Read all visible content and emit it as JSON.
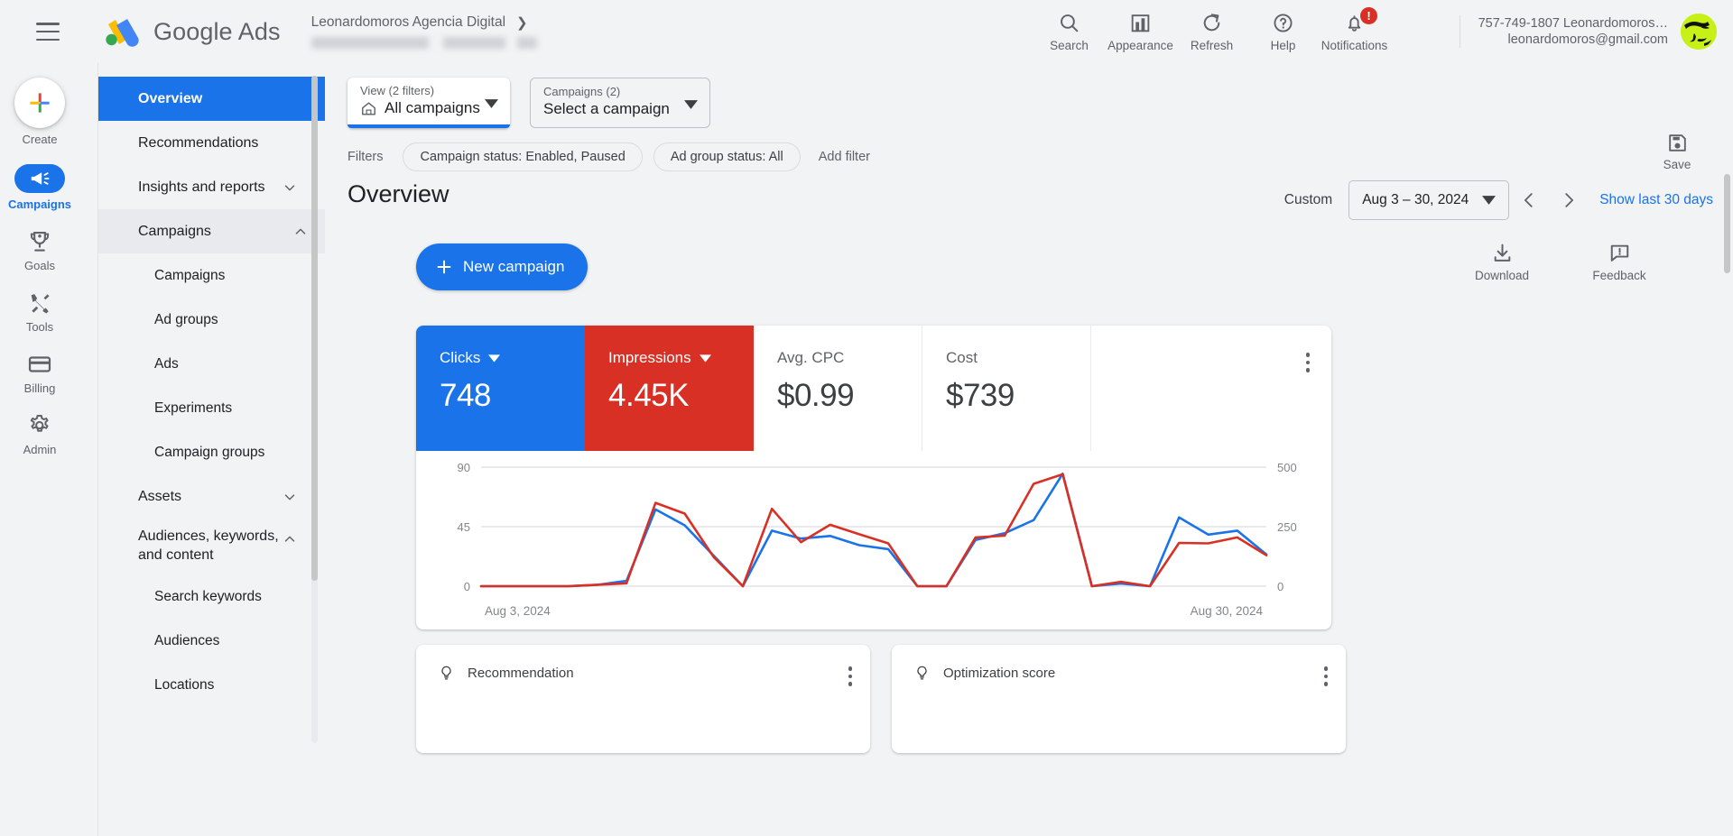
{
  "topbar": {
    "brand_google": "Google",
    "brand_ads": "Ads",
    "account_breadcrumb": "Leonardomoros Agencia Digital",
    "tools": [
      {
        "label": "Search",
        "icon": "search-icon"
      },
      {
        "label": "Appearance",
        "icon": "appearance-icon"
      },
      {
        "label": "Refresh",
        "icon": "refresh-icon"
      },
      {
        "label": "Help",
        "icon": "help-icon"
      },
      {
        "label": "Notifications",
        "icon": "bell-icon",
        "badge": "!"
      }
    ],
    "account_id": "757-749-1807 Leonardomoros…",
    "account_email": "leonardomoros@gmail.com"
  },
  "rail": {
    "items": [
      {
        "label": "Create",
        "icon": "plus-icon"
      },
      {
        "label": "Campaigns",
        "icon": "megaphone-icon",
        "active": true
      },
      {
        "label": "Goals",
        "icon": "trophy-icon"
      },
      {
        "label": "Tools",
        "icon": "tools-icon"
      },
      {
        "label": "Billing",
        "icon": "credit-card-icon"
      },
      {
        "label": "Admin",
        "icon": "gear-icon"
      }
    ]
  },
  "sidebar": {
    "items": [
      {
        "label": "Overview",
        "state": "selected"
      },
      {
        "label": "Recommendations",
        "state": "normal"
      },
      {
        "label": "Insights and reports",
        "state": "collapsed"
      },
      {
        "label": "Campaigns",
        "state": "expanded"
      },
      {
        "label": "Campaigns",
        "state": "child"
      },
      {
        "label": "Ad groups",
        "state": "child"
      },
      {
        "label": "Ads",
        "state": "child"
      },
      {
        "label": "Experiments",
        "state": "child"
      },
      {
        "label": "Campaign groups",
        "state": "child"
      },
      {
        "label": "Assets",
        "state": "collapsed"
      },
      {
        "label": "Audiences, keywords, and content",
        "state": "expanded_two_line"
      },
      {
        "label": "Search keywords",
        "state": "child"
      },
      {
        "label": "Audiences",
        "state": "child"
      },
      {
        "label": "Locations",
        "state": "child"
      }
    ]
  },
  "main": {
    "view_selector": {
      "caption": "View (2 filters)",
      "value": "All campaigns"
    },
    "campaign_selector": {
      "caption": "Campaigns (2)",
      "value": "Select a campaign"
    },
    "filters_label": "Filters",
    "filter_chips": [
      "Campaign status: Enabled, Paused",
      "Ad group status: All"
    ],
    "add_filter": "Add filter",
    "save_label": "Save",
    "page_title": "Overview",
    "date_custom_label": "Custom",
    "date_range": "Aug 3 – 30, 2024",
    "show_last_30": "Show last 30 days",
    "new_campaign": "New campaign",
    "download_label": "Download",
    "feedback_label": "Feedback",
    "stats": [
      {
        "name": "Clicks",
        "value": "748",
        "style": "blue",
        "has_caret": true
      },
      {
        "name": "Impressions",
        "value": "4.45K",
        "style": "red",
        "has_caret": true
      },
      {
        "name": "Avg. CPC",
        "value": "$0.99",
        "style": "plain",
        "has_caret": false
      },
      {
        "name": "Cost",
        "value": "$739",
        "style": "plain",
        "has_caret": false
      }
    ],
    "bottom_cards": [
      {
        "title": "Recommendation",
        "icon": "lightbulb-icon"
      },
      {
        "title": "Optimization score",
        "icon": "lightbulb-icon"
      }
    ]
  },
  "chart_data": {
    "type": "line",
    "title": "",
    "xlabel": "",
    "ylabel": "Clicks",
    "grid": true,
    "legend": "none",
    "x_tick_labels": [
      "Aug 3, 2024",
      "Aug 30, 2024"
    ],
    "left_axis": {
      "name": "Clicks",
      "ticks": [
        0,
        45,
        90
      ],
      "ylim": [
        0,
        90
      ],
      "color": "#1a73e8"
    },
    "right_axis": {
      "name": "Impressions",
      "ticks": [
        0,
        250,
        500
      ],
      "ylim": [
        0,
        500
      ],
      "color": "#d93025"
    },
    "x": [
      "Aug 3",
      "Aug 4",
      "Aug 5",
      "Aug 6",
      "Aug 7",
      "Aug 8",
      "Aug 9",
      "Aug 10",
      "Aug 11",
      "Aug 12",
      "Aug 13",
      "Aug 14",
      "Aug 15",
      "Aug 16",
      "Aug 17",
      "Aug 18",
      "Aug 19",
      "Aug 20",
      "Aug 21",
      "Aug 22",
      "Aug 23",
      "Aug 24",
      "Aug 25",
      "Aug 26",
      "Aug 27",
      "Aug 28",
      "Aug 29",
      "Aug 30"
    ],
    "series": [
      {
        "name": "Clicks",
        "color": "#1a73e8",
        "axis": "left",
        "values": [
          0,
          0,
          0,
          0,
          1,
          4,
          58,
          46,
          23,
          0,
          42,
          36,
          38,
          31,
          28,
          0,
          0,
          35,
          40,
          50,
          85,
          0,
          2,
          0,
          52,
          39,
          42,
          24
        ]
      },
      {
        "name": "Impressions",
        "color": "#d93025",
        "axis": "right",
        "values": [
          0,
          0,
          0,
          0,
          6,
          12,
          350,
          305,
          122,
          0,
          325,
          185,
          258,
          218,
          180,
          0,
          0,
          205,
          212,
          430,
          470,
          0,
          18,
          0,
          182,
          180,
          205,
          130
        ]
      }
    ]
  }
}
